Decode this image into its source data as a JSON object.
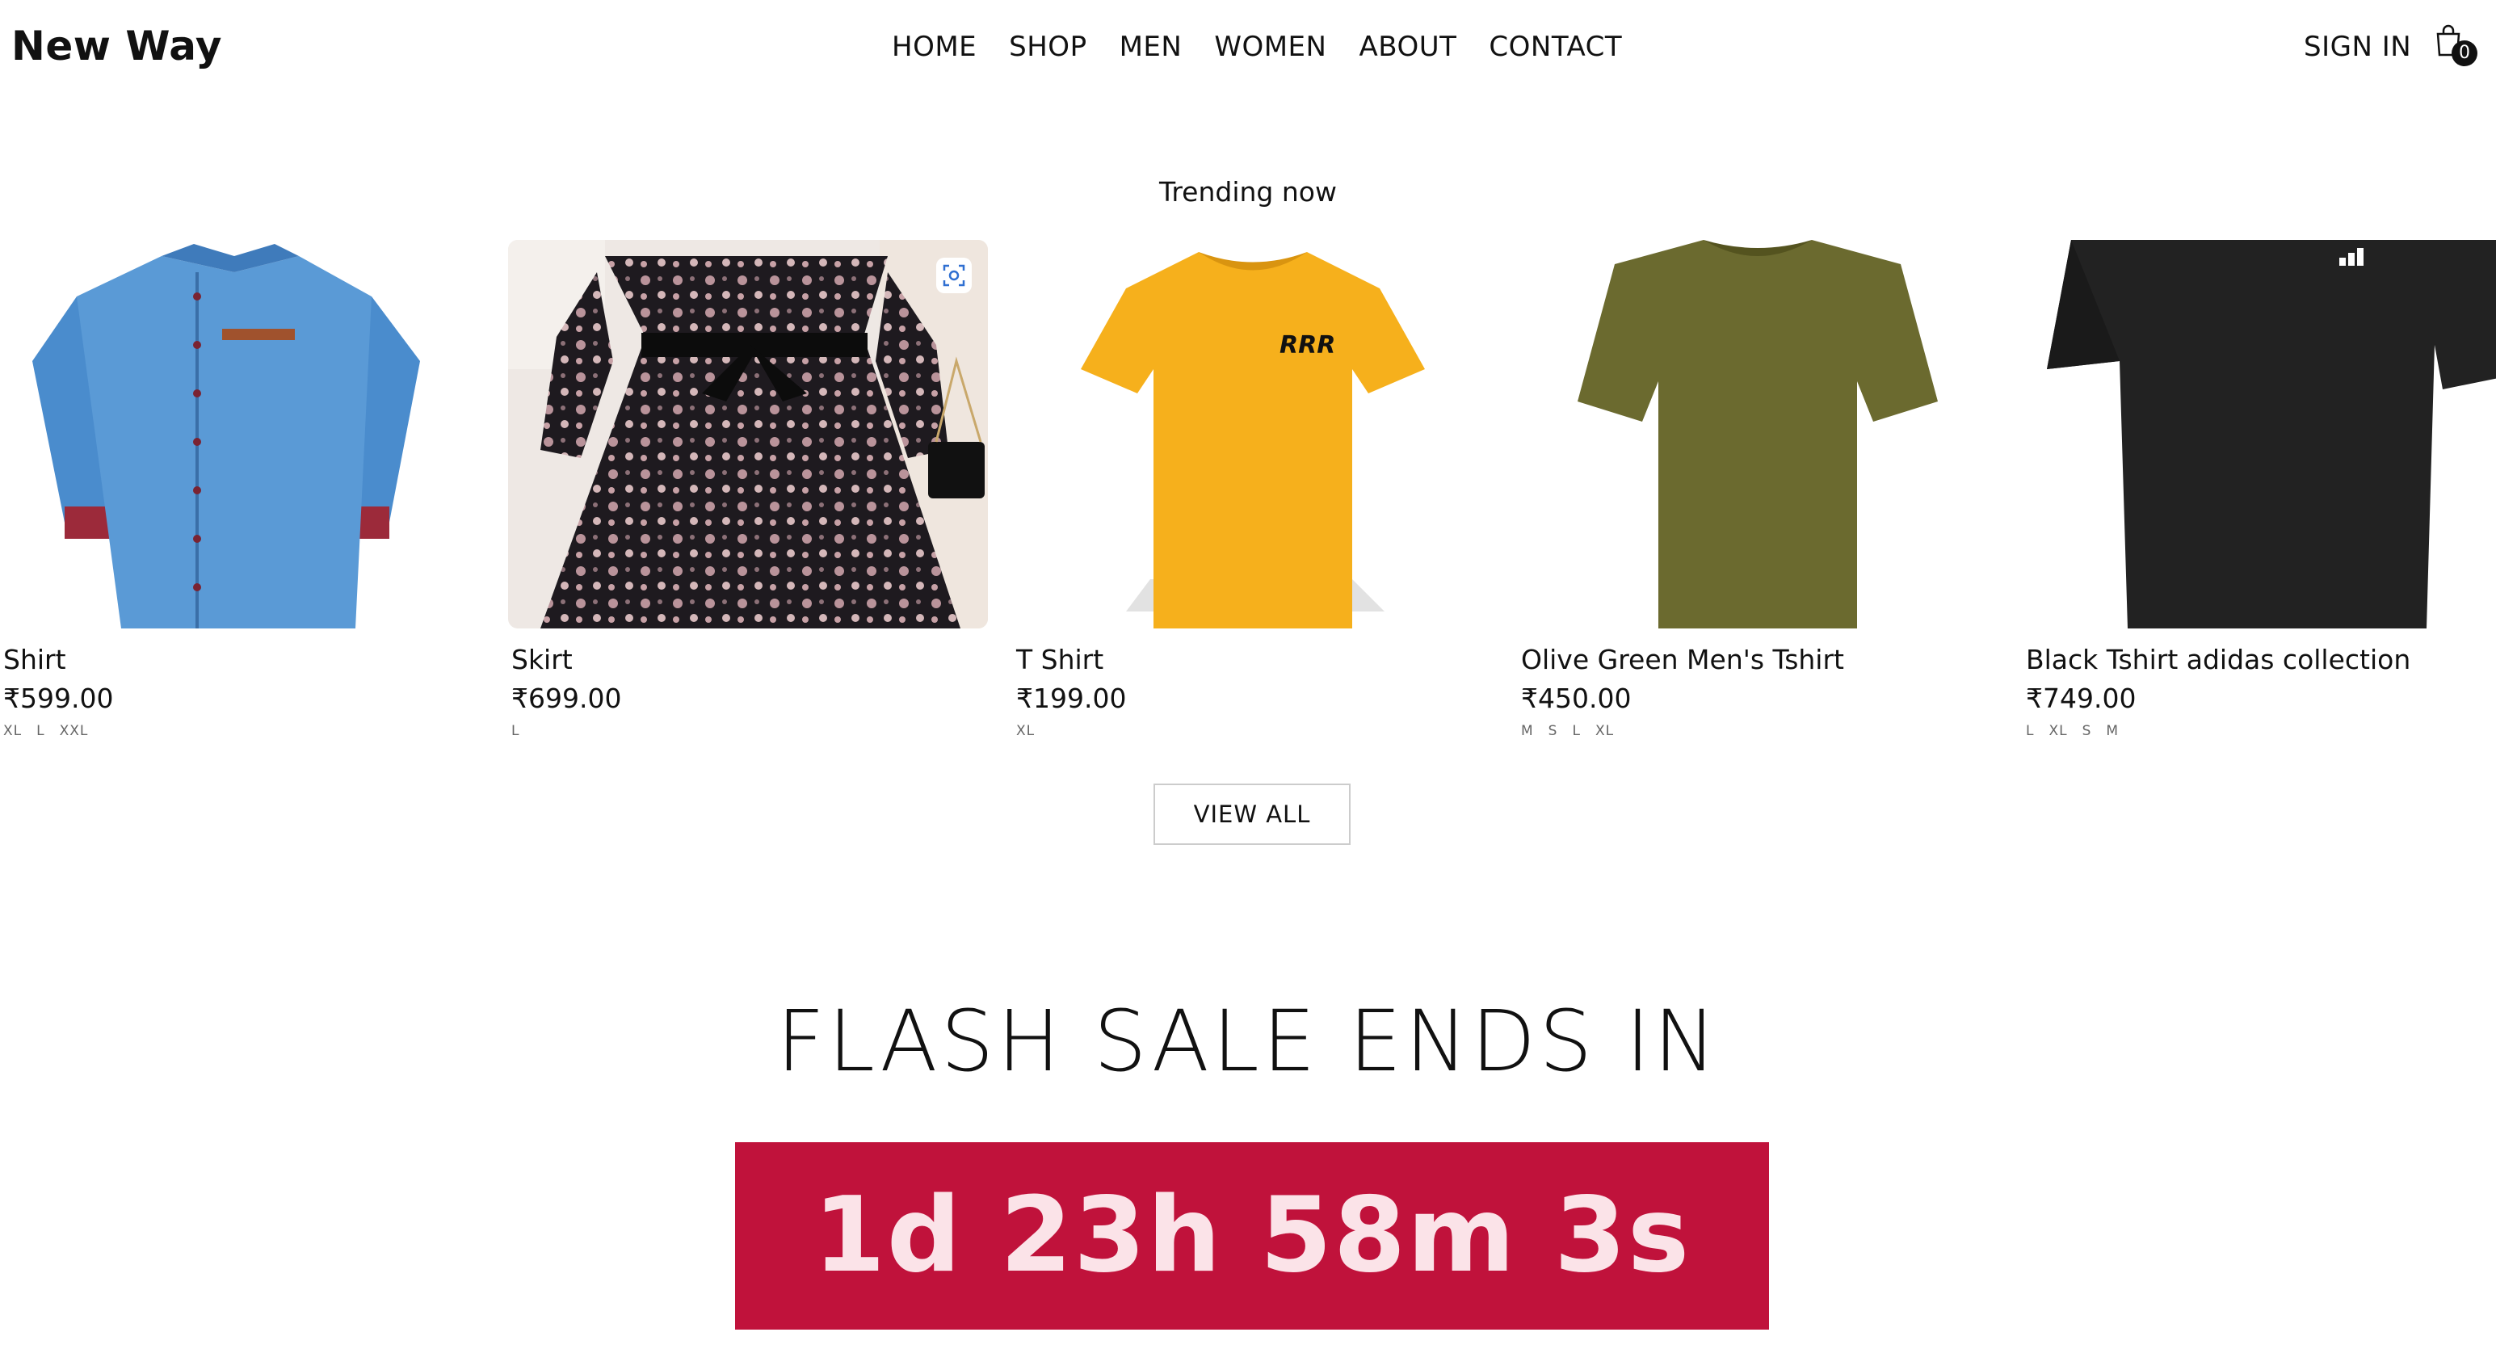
{
  "header": {
    "logo": "New Way",
    "nav": [
      "HOME",
      "SHOP",
      "MEN",
      "WOMEN",
      "ABOUT",
      "CONTACT"
    ],
    "sign_in": "SIGN IN",
    "cart_count": "0"
  },
  "trending": {
    "title": "Trending now",
    "products": [
      {
        "name": "Shirt",
        "price": "₹599.00",
        "sizes": [
          "XL",
          "L",
          "XXL"
        ],
        "image": "blue-denim-shirt"
      },
      {
        "name": "Skirt",
        "price": "₹699.00",
        "sizes": [
          "L"
        ],
        "image": "floral-dress"
      },
      {
        "name": "T Shirt",
        "price": "₹199.00",
        "sizes": [
          "XL"
        ],
        "image": "yellow-tshirt"
      },
      {
        "name": "Olive Green Men's Tshirt",
        "price": "₹450.00",
        "sizes": [
          "M",
          "S",
          "L",
          "XL"
        ],
        "image": "olive-tshirt"
      },
      {
        "name": "Black Tshirt adidas collection",
        "price": "₹749.00",
        "sizes": [
          "L",
          "XL",
          "S",
          "M"
        ],
        "image": "black-adidas-tshirt"
      }
    ],
    "view_all": "VIEW ALL"
  },
  "flash_sale": {
    "title": "FLASH SALE ENDS IN",
    "countdown": "1d 23h 58m 3s"
  },
  "colors": {
    "flash_bg": "#c0123b",
    "countdown_text": "#fbe3e8",
    "shirt_blue": "#4d8fcf",
    "yellow": "#f7b21f",
    "olive": "#6b6a2e",
    "black_tee": "#222222"
  }
}
